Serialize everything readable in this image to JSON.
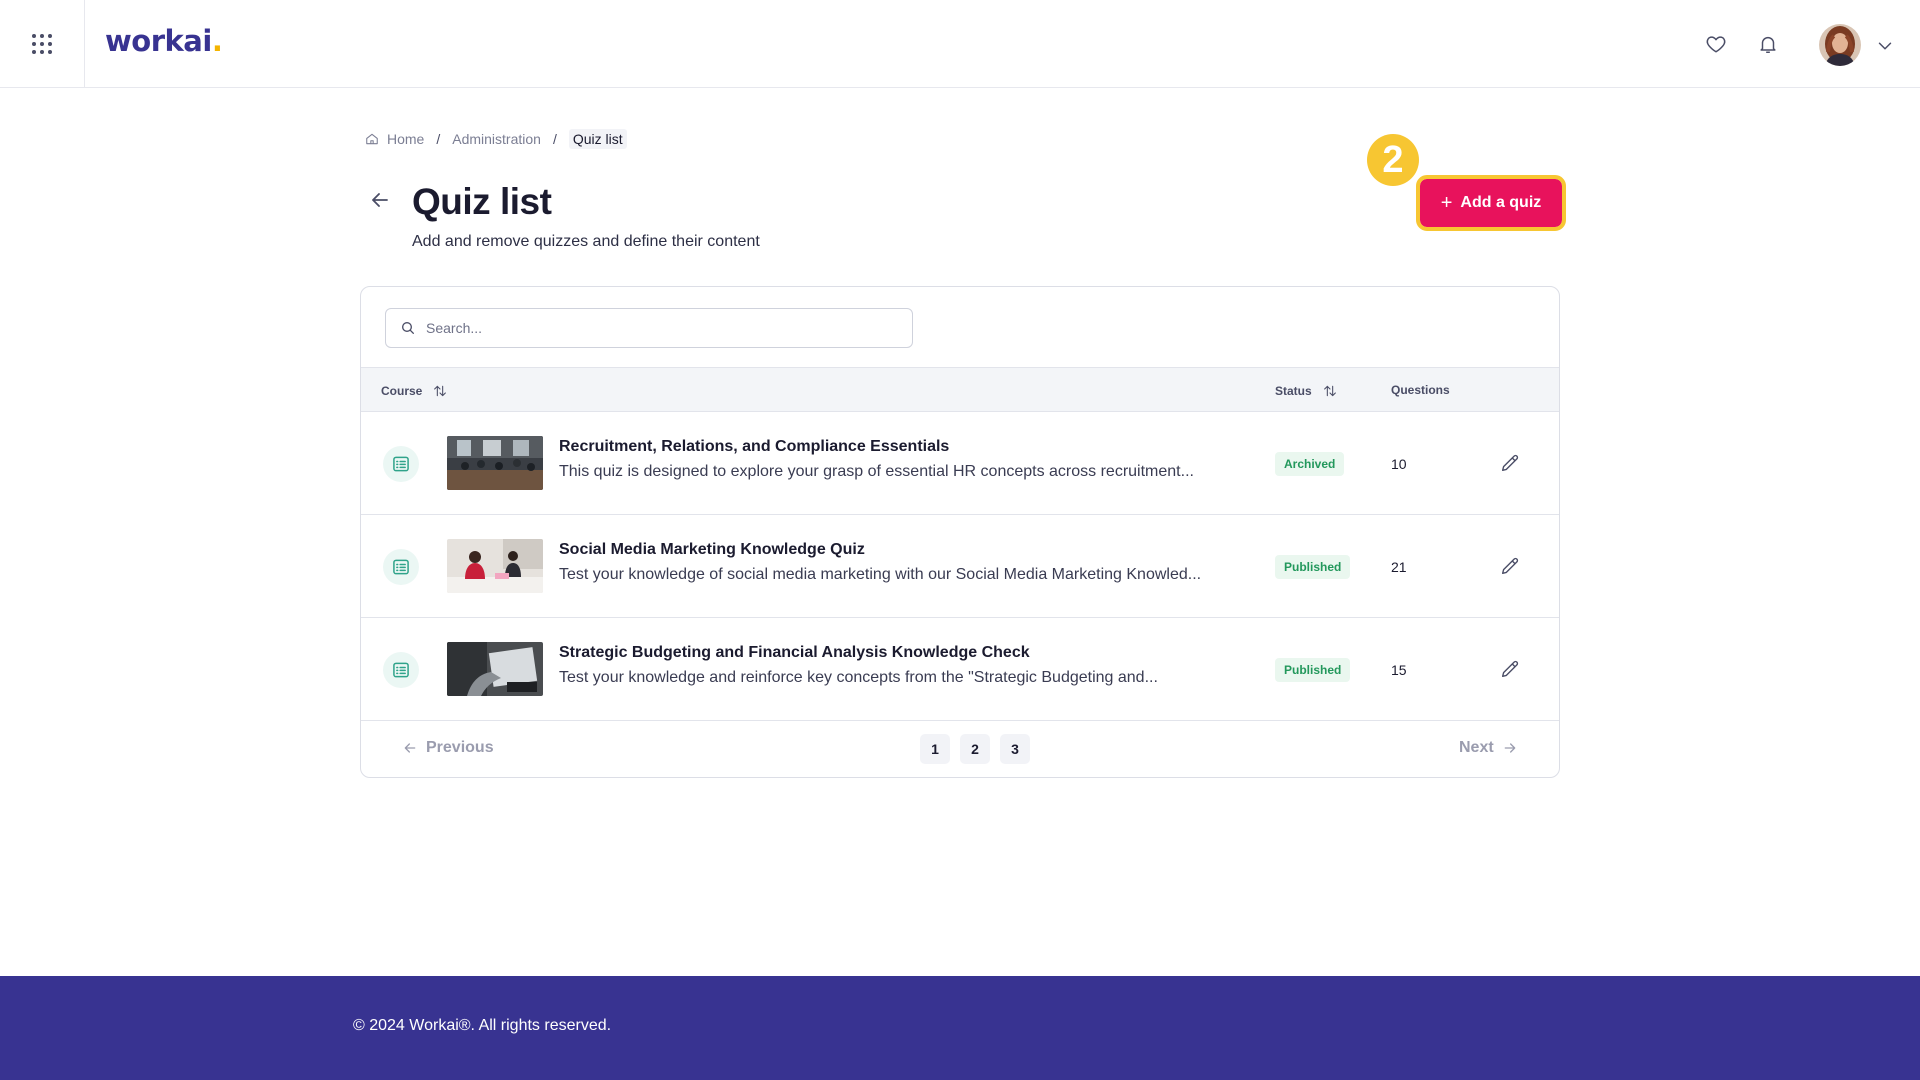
{
  "header": {
    "logo_text": "workai",
    "logo_dot": ".",
    "icons": [
      "apps-grid-icon",
      "heart-icon",
      "bell-icon",
      "chevron-down-icon"
    ]
  },
  "breadcrumb": {
    "home": "Home",
    "separator": "/",
    "administration": "Administration",
    "current": "Quiz list"
  },
  "page": {
    "title": "Quiz list",
    "subtitle": "Add and remove quizzes and define their content",
    "step_number": "2",
    "add_button_label": "Add a quiz",
    "add_button_icon": "+"
  },
  "search": {
    "placeholder": "Search...",
    "value": ""
  },
  "table": {
    "columns": {
      "course": "Course",
      "status": "Status",
      "questions": "Questions"
    },
    "rows": [
      {
        "title": "Recruitment, Relations, and Compliance Essentials",
        "description": "This quiz is designed to explore your grasp of essential HR concepts across recruitment...",
        "status": "Archived",
        "questions": "10"
      },
      {
        "title": "Social Media Marketing Knowledge Quiz",
        "description": "Test your knowledge of social media marketing with our Social Media Marketing Knowled...",
        "status": "Published",
        "questions": "21"
      },
      {
        "title": "Strategic Budgeting and Financial Analysis Knowledge Check",
        "description": "Test your knowledge and reinforce key concepts from the \"Strategic Budgeting and...",
        "status": "Published",
        "questions": "15"
      }
    ]
  },
  "pagination": {
    "previous": "Previous",
    "next": "Next",
    "pages": [
      "1",
      "2",
      "3"
    ]
  },
  "footer": {
    "copyright": "© 2024 Workai®. All rights reserved."
  },
  "colors": {
    "brand_primary": "#383391",
    "accent_pink": "#e8125c",
    "highlight_yellow": "#f7c632",
    "status_green": "#23985c",
    "icon_teal": "#2fa38a"
  }
}
